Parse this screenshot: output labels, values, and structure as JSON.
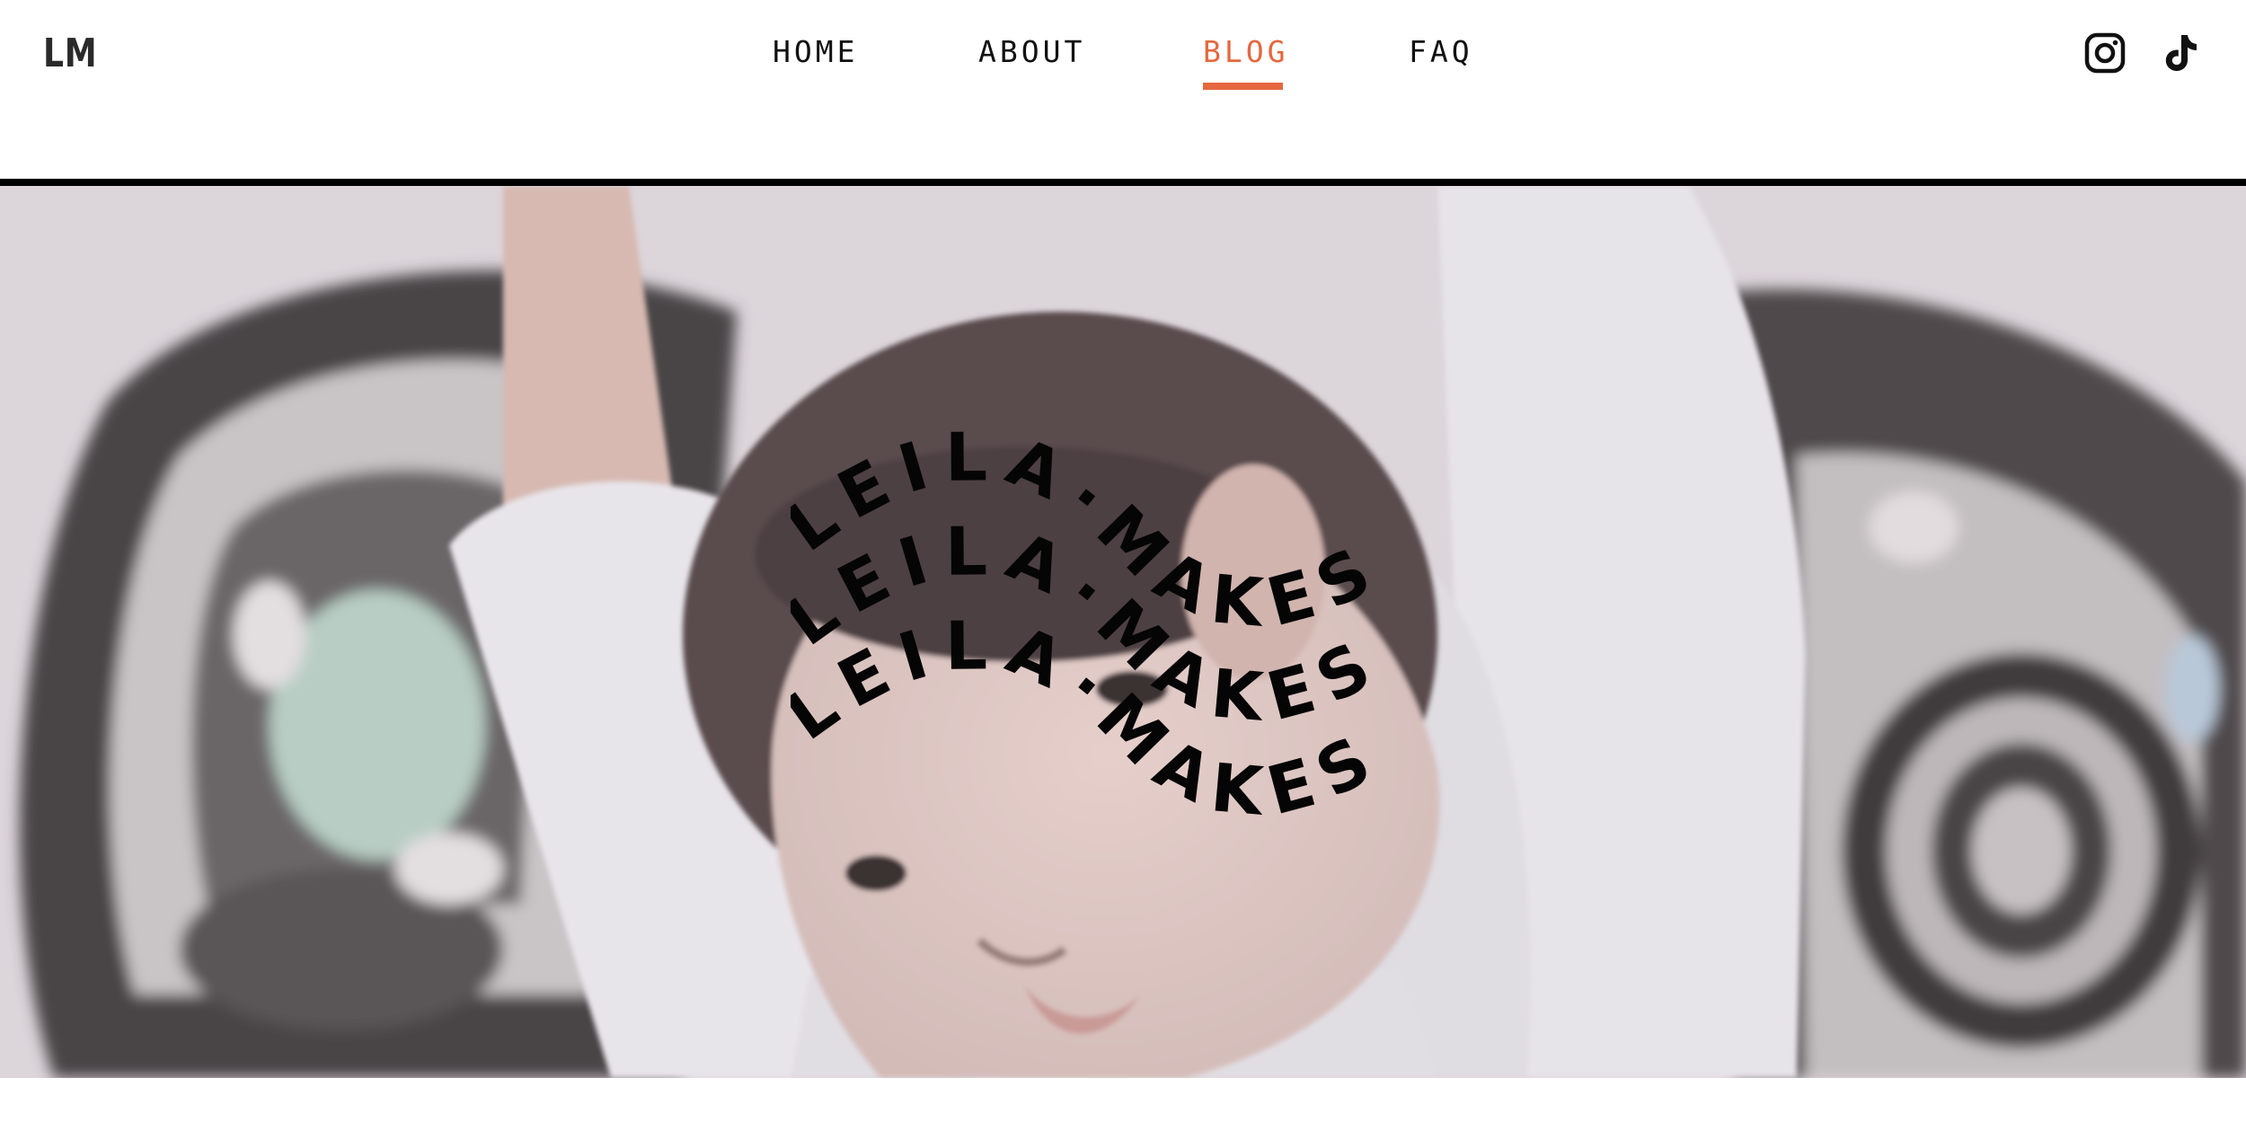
{
  "brand": {
    "logo_text": "LM",
    "accent_color": "#e5683e"
  },
  "nav": {
    "items": [
      {
        "label": "HOME",
        "active": false
      },
      {
        "label": "ABOUT",
        "active": false
      },
      {
        "label": "BLOG",
        "active": true
      },
      {
        "label": "FAQ",
        "active": false
      }
    ]
  },
  "social": {
    "icons": [
      "instagram-icon",
      "tiktok-icon"
    ]
  },
  "hero": {
    "wave_text": [
      "LEILA·MAKES",
      "LEILA·MAKES",
      "LEILA·MAKES"
    ]
  }
}
